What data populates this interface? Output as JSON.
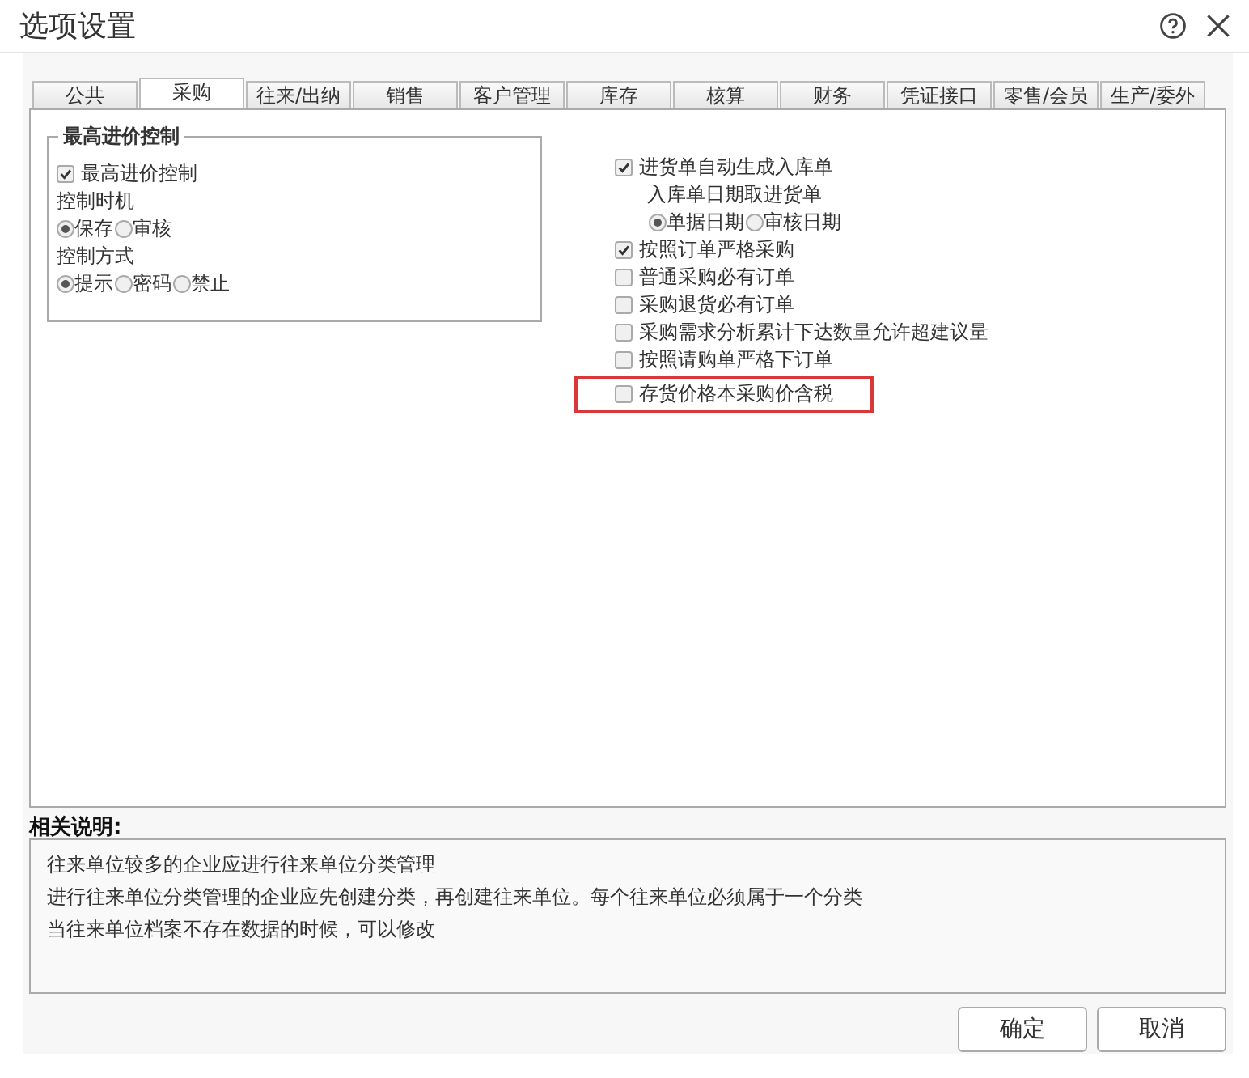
{
  "window": {
    "title": "选项设置"
  },
  "tabs": [
    {
      "label": "公共",
      "selected": false
    },
    {
      "label": "采购",
      "selected": true
    },
    {
      "label": "往来/出纳",
      "selected": false
    },
    {
      "label": "销售",
      "selected": false
    },
    {
      "label": "客户管理",
      "selected": false
    },
    {
      "label": "库存",
      "selected": false
    },
    {
      "label": "核算",
      "selected": false
    },
    {
      "label": "财务",
      "selected": false
    },
    {
      "label": "凭证接口",
      "selected": false
    },
    {
      "label": "零售/会员",
      "selected": false
    },
    {
      "label": "生产/委外",
      "selected": false
    }
  ],
  "group": {
    "title": "最高进价控制",
    "items": [
      {
        "kind": "checkbox",
        "label": "最高进价控制",
        "checked": true
      },
      {
        "kind": "label",
        "label": "控制时机"
      },
      {
        "kind": "radios",
        "options": [
          {
            "label": "保存",
            "selected": true
          },
          {
            "label": "审核",
            "selected": false
          }
        ]
      },
      {
        "kind": "label",
        "label": "控制方式"
      },
      {
        "kind": "radios",
        "options": [
          {
            "label": "提示",
            "selected": true
          },
          {
            "label": "密码",
            "selected": false
          },
          {
            "label": "禁止",
            "selected": false
          }
        ]
      }
    ]
  },
  "options": [
    {
      "kind": "checkbox",
      "label": "进货单自动生成入库单",
      "checked": true,
      "highlighted": false,
      "children": [
        {
          "kind": "label",
          "label": "入库单日期取进货单"
        },
        {
          "kind": "radios",
          "options": [
            {
              "label": "单据日期",
              "selected": true
            },
            {
              "label": "审核日期",
              "selected": false
            }
          ]
        }
      ]
    },
    {
      "kind": "checkbox",
      "label": "按照订单严格采购",
      "checked": true,
      "highlighted": false
    },
    {
      "kind": "checkbox",
      "label": "普通采购必有订单",
      "checked": false,
      "highlighted": false
    },
    {
      "kind": "checkbox",
      "label": "采购退货必有订单",
      "checked": false,
      "highlighted": false
    },
    {
      "kind": "checkbox",
      "label": "采购需求分析累计下达数量允许超建议量",
      "checked": false,
      "highlighted": false
    },
    {
      "kind": "checkbox",
      "label": "按照请购单严格下订单",
      "checked": false,
      "highlighted": false
    },
    {
      "kind": "checkbox",
      "label": "存货价格本采购价含税",
      "checked": false,
      "highlighted": true
    }
  ],
  "description": {
    "title": "相关说明:",
    "lines": [
      "往来单位较多的企业应进行往来单位分类管理",
      "进行往来单位分类管理的企业应先创建分类，再创建往来单位。每个往来单位必须属于一个分类",
      "当往来单位档案不存在数据的时候，可以修改"
    ]
  },
  "buttons": [
    "确定",
    "取消"
  ]
}
